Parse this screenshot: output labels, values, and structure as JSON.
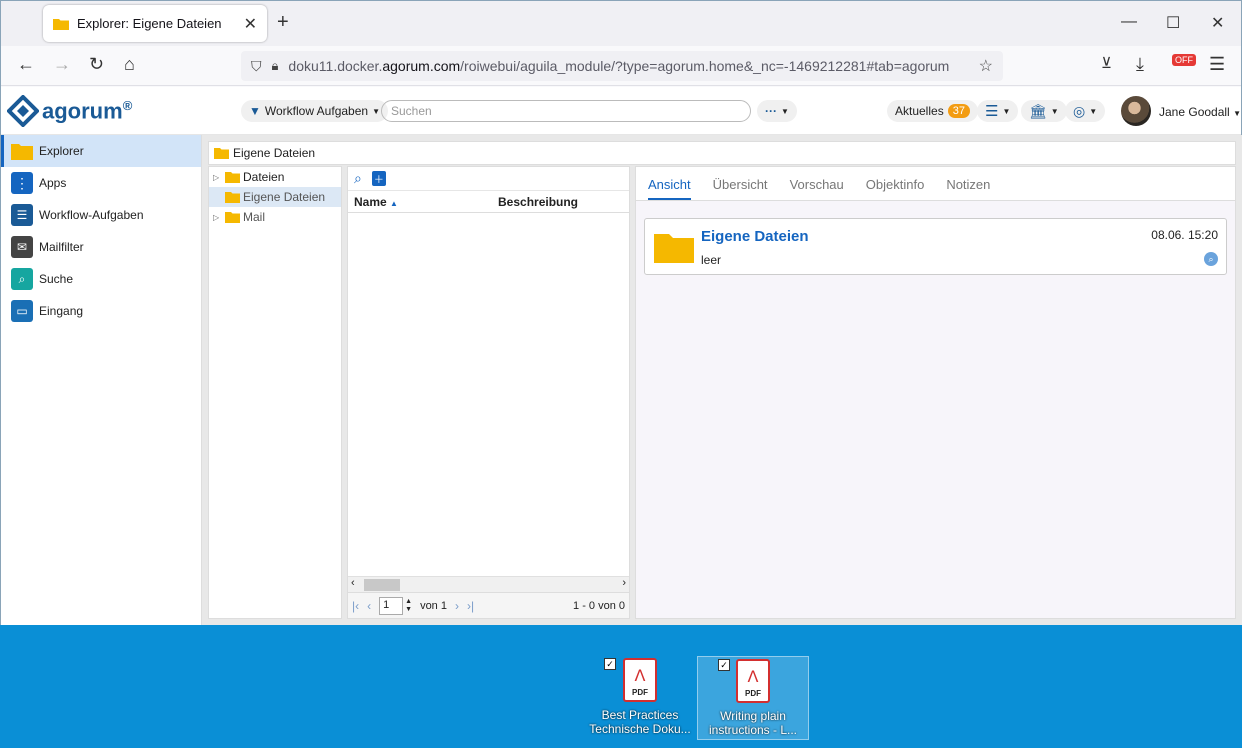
{
  "browser": {
    "tab_title": "Explorer: Eigene Dateien",
    "url_prefix": "doku11.docker.",
    "url_domain": "agorum.com",
    "url_rest": "/roiwebui/aguila_module/?type=agorum.home&_nc=-1469212281#tab=agorum"
  },
  "header": {
    "logo_text": "agorum",
    "logo_sup": "®",
    "workflow_label": "Workflow Aufgaben",
    "search_placeholder": "Suchen",
    "more_label": "···",
    "aktuelles_label": "Aktuelles",
    "aktuelles_count": "37",
    "user_name": "Jane Goodall"
  },
  "sidebar": {
    "items": [
      {
        "label": "Explorer",
        "icon": "folder-icon"
      },
      {
        "label": "Apps",
        "icon": "grid-icon"
      },
      {
        "label": "Workflow-Aufgaben",
        "icon": "clipboard-icon"
      },
      {
        "label": "Mailfilter",
        "icon": "mail-filter-icon"
      },
      {
        "label": "Suche",
        "icon": "magnifier-icon"
      },
      {
        "label": "Eingang",
        "icon": "inbox-icon"
      }
    ]
  },
  "breadcrumb": {
    "label": "Eigene Dateien"
  },
  "tree": {
    "items": [
      {
        "label": "Dateien"
      },
      {
        "label": "Eigene Dateien"
      },
      {
        "label": "Mail"
      }
    ]
  },
  "list": {
    "col_name": "Name",
    "col_desc": "Beschreibung",
    "page_value": "1",
    "page_of": "von 1",
    "range": "1 - 0 von 0"
  },
  "detail": {
    "tabs": [
      "Ansicht",
      "Übersicht",
      "Vorschau",
      "Objektinfo",
      "Notizen"
    ],
    "card_title": "Eigene Dateien",
    "card_desc": "leer",
    "card_date": "08.06. 15:20"
  },
  "desktop": {
    "icons": [
      {
        "line1": "Best Practices",
        "line2": "Technische Doku..."
      },
      {
        "line1": "Writing plain",
        "line2": "instructions - L..."
      }
    ]
  },
  "colors": {
    "accent": "#1565c0",
    "desktop": "#0a8fd6",
    "folder": "#f5b800",
    "badge": "#f39c12",
    "pdf": "#d32f2f"
  }
}
